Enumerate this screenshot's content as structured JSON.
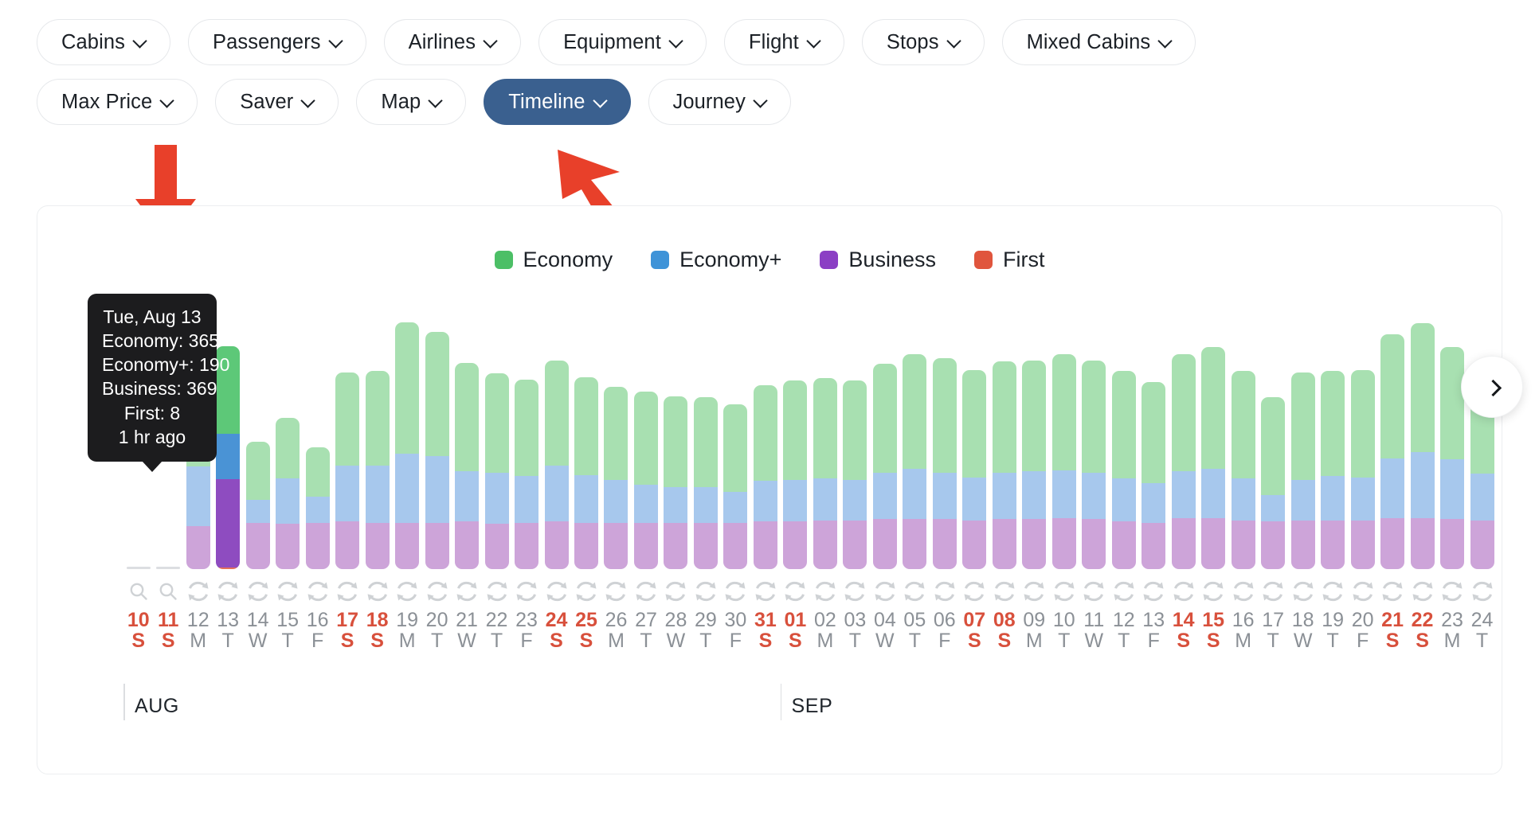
{
  "filters": {
    "row1": [
      {
        "label": "Cabins",
        "active": false
      },
      {
        "label": "Passengers",
        "active": false
      },
      {
        "label": "Airlines",
        "active": false
      },
      {
        "label": "Equipment",
        "active": false
      },
      {
        "label": "Flight",
        "active": false
      },
      {
        "label": "Stops",
        "active": false
      },
      {
        "label": "Mixed Cabins",
        "active": false
      }
    ],
    "row2": [
      {
        "label": "Max Price",
        "active": false
      },
      {
        "label": "Saver",
        "active": false
      },
      {
        "label": "Map",
        "active": false
      },
      {
        "label": "Timeline",
        "active": true
      },
      {
        "label": "Journey",
        "active": false
      }
    ]
  },
  "annotations": {
    "arrow_down_color": "#e8402a",
    "arrow_cursor_color": "#e8402a",
    "arrow_down_target": "hovered-bar-aug-13",
    "arrow_cursor_target": "timeline-filter-chip"
  },
  "tooltip": {
    "date": "Tue, Aug 13",
    "economy": "Economy: 365",
    "economy_plus": "Economy+: 190",
    "business": "Business: 369",
    "first": "First: 8",
    "updated": "1 hr ago",
    "bg": "#1c1c1e"
  },
  "next_button": {
    "icon": "chevron-right-icon"
  },
  "colors": {
    "legend_economy": "#4cbf66",
    "legend_economy_plus": "#3e93d8",
    "legend_business": "#8b3fc4",
    "legend_first": "#e0553d",
    "bar_economy": "#a8e0b1",
    "bar_economy_plus": "#a7c8ed",
    "bar_business": "#cda4d9",
    "bar_first": "#e89a8c",
    "hover_economy": "#5dc878",
    "hover_economy_plus": "#4a93d5",
    "hover_business": "#8e4cc0",
    "hover_first": "#e5715a",
    "weekend_text": "#d8503c",
    "weekday_text": "#8b9096",
    "active_chip": "#3a608f",
    "baseline_stub": "#dcdee1"
  },
  "months": [
    {
      "label": "AUG",
      "start_index": 0
    },
    {
      "label": "SEP",
      "start_index": 22
    }
  ],
  "chart_data": {
    "type": "bar",
    "stacked": true,
    "title": "",
    "xlabel": "",
    "ylabel": "",
    "grid": false,
    "legend_position": "top-center",
    "legend": [
      "Economy",
      "Economy+",
      "Business",
      "First"
    ],
    "series_colors": [
      "#a8e0b1",
      "#a7c8ed",
      "#cda4d9",
      "#e89a8c"
    ],
    "hovered_index": 3,
    "hovered_category": "13",
    "icon_row": [
      "search-icon",
      "search-icon",
      "refresh-icon",
      "refresh-icon",
      "refresh-icon",
      "refresh-icon",
      "refresh-icon",
      "refresh-icon",
      "refresh-icon",
      "refresh-icon",
      "refresh-icon",
      "refresh-icon",
      "refresh-icon",
      "refresh-icon",
      "refresh-icon",
      "refresh-icon",
      "refresh-icon",
      "refresh-icon",
      "refresh-icon",
      "refresh-icon",
      "refresh-icon",
      "refresh-icon",
      "refresh-icon",
      "refresh-icon",
      "refresh-icon",
      "refresh-icon",
      "refresh-icon",
      "refresh-icon",
      "refresh-icon",
      "refresh-icon",
      "refresh-icon",
      "refresh-icon",
      "refresh-icon",
      "refresh-icon",
      "refresh-icon",
      "refresh-icon",
      "refresh-icon",
      "refresh-icon",
      "refresh-icon",
      "refresh-icon",
      "refresh-icon",
      "refresh-icon",
      "refresh-icon",
      "refresh-icon",
      "refresh-icon",
      "refresh-icon"
    ],
    "categories": [
      "10",
      "11",
      "12",
      "13",
      "14",
      "15",
      "16",
      "17",
      "18",
      "19",
      "20",
      "21",
      "22",
      "23",
      "24",
      "25",
      "26",
      "27",
      "28",
      "29",
      "30",
      "31",
      "01",
      "02",
      "03",
      "04",
      "05",
      "06",
      "07",
      "08",
      "09",
      "10",
      "11",
      "12",
      "13",
      "14",
      "15",
      "16",
      "17",
      "18",
      "19",
      "20",
      "21",
      "22",
      "23",
      "24"
    ],
    "day_of_week": [
      "S",
      "S",
      "M",
      "T",
      "W",
      "T",
      "F",
      "S",
      "S",
      "M",
      "T",
      "W",
      "T",
      "F",
      "S",
      "S",
      "M",
      "T",
      "W",
      "T",
      "F",
      "S",
      "S",
      "M",
      "T",
      "W",
      "T",
      "F",
      "S",
      "S",
      "M",
      "T",
      "W",
      "T",
      "F",
      "S",
      "S",
      "M",
      "T",
      "W",
      "T",
      "F",
      "S",
      "S",
      "M",
      "T"
    ],
    "weekend_flags": [
      true,
      true,
      false,
      false,
      false,
      false,
      false,
      true,
      true,
      false,
      false,
      false,
      false,
      false,
      true,
      true,
      false,
      false,
      false,
      false,
      false,
      true,
      true,
      false,
      false,
      false,
      false,
      false,
      true,
      true,
      false,
      false,
      false,
      false,
      false,
      true,
      true,
      false,
      false,
      false,
      false,
      false,
      true,
      true,
      false,
      false
    ],
    "series": [
      {
        "name": "Economy",
        "values": [
          0,
          0,
          365,
          365,
          245,
          255,
          205,
          390,
          395,
          550,
          520,
          455,
          415,
          405,
          440,
          410,
          390,
          390,
          380,
          375,
          365,
          400,
          415,
          420,
          415,
          455,
          480,
          480,
          450,
          465,
          465,
          485,
          470,
          450,
          425,
          490,
          510,
          450,
          410,
          450,
          440,
          450,
          520,
          540,
          470,
          440
        ]
      },
      {
        "name": "Economy+",
        "values": [
          0,
          0,
          250,
          190,
          95,
          190,
          110,
          235,
          240,
          290,
          280,
          210,
          215,
          195,
          235,
          200,
          180,
          160,
          150,
          150,
          130,
          170,
          175,
          175,
          170,
          195,
          210,
          195,
          180,
          195,
          200,
          200,
          195,
          180,
          165,
          195,
          205,
          175,
          110,
          170,
          185,
          180,
          250,
          275,
          250,
          195
        ]
      },
      {
        "name": "Business",
        "values": [
          0,
          0,
          180,
          369,
          195,
          190,
          195,
          200,
          195,
          195,
          195,
          200,
          190,
          195,
          200,
          195,
          195,
          195,
          195,
          195,
          195,
          200,
          200,
          205,
          205,
          210,
          210,
          210,
          205,
          210,
          210,
          215,
          210,
          200,
          195,
          215,
          215,
          205,
          200,
          205,
          205,
          205,
          215,
          215,
          210,
          205
        ]
      },
      {
        "name": "First",
        "values": [
          0,
          0,
          0,
          8,
          0,
          0,
          0,
          0,
          0,
          0,
          0,
          0,
          0,
          0,
          0,
          0,
          0,
          0,
          0,
          0,
          0,
          0,
          0,
          0,
          0,
          0,
          0,
          0,
          0,
          0,
          0,
          0,
          0,
          0,
          0,
          0,
          0,
          0,
          0,
          0,
          0,
          0,
          0,
          0,
          0,
          0
        ]
      }
    ],
    "ylim": [
      0,
      1100
    ],
    "note": "First two slots (Aug 10, Aug 11) have no data - shown as flat baseline stubs"
  }
}
